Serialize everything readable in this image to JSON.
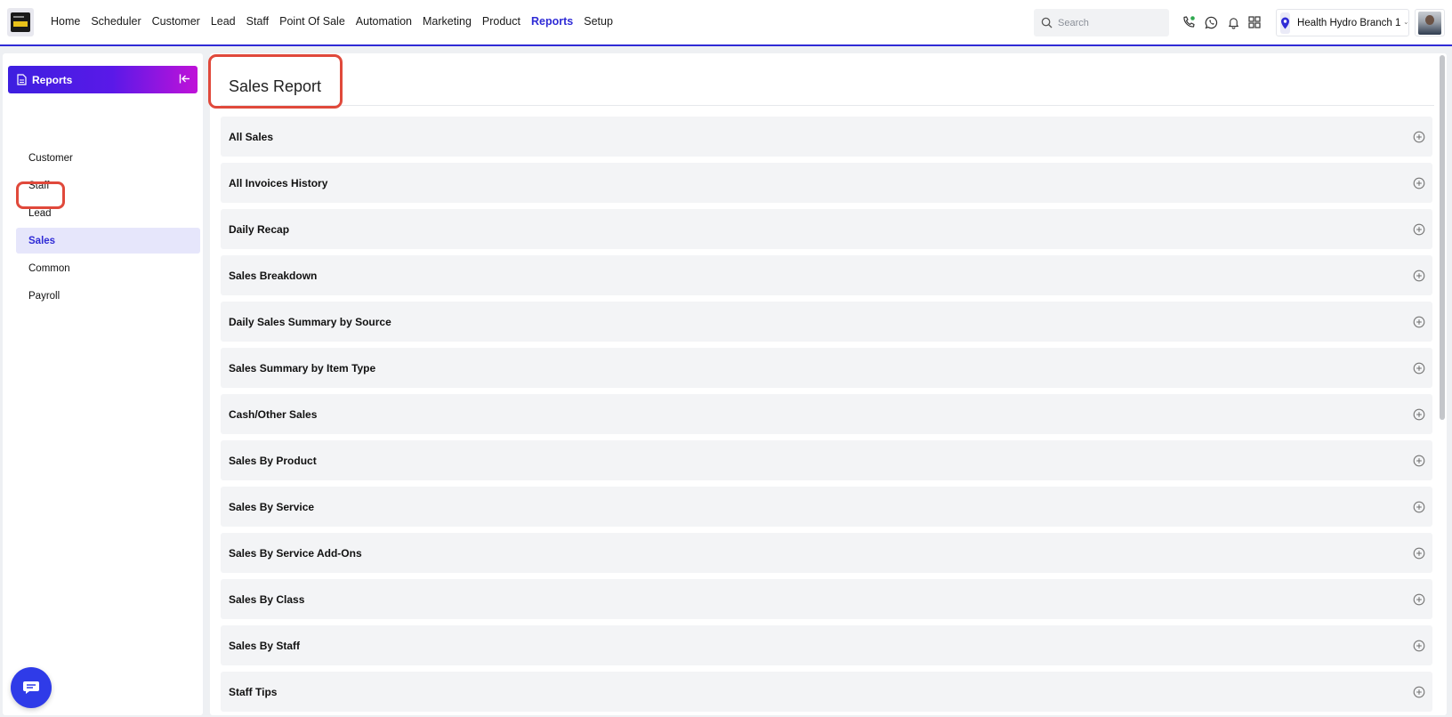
{
  "nav": {
    "items": [
      {
        "label": "Home",
        "active": false
      },
      {
        "label": "Scheduler",
        "active": false
      },
      {
        "label": "Customer",
        "active": false
      },
      {
        "label": "Lead",
        "active": false
      },
      {
        "label": "Staff",
        "active": false
      },
      {
        "label": "Point Of Sale",
        "active": false
      },
      {
        "label": "Automation",
        "active": false
      },
      {
        "label": "Marketing",
        "active": false
      },
      {
        "label": "Product",
        "active": false
      },
      {
        "label": "Reports",
        "active": true
      },
      {
        "label": "Setup",
        "active": false
      }
    ],
    "search_placeholder": "Search",
    "branch": "Health Hydro Branch 1",
    "accent": "#2f2bd6"
  },
  "sidebar": {
    "title": "Reports",
    "items": [
      {
        "label": "Customer",
        "active": false
      },
      {
        "label": "Staff",
        "active": false
      },
      {
        "label": "Lead",
        "active": false
      },
      {
        "label": "Sales",
        "active": true
      },
      {
        "label": "Common",
        "active": false
      },
      {
        "label": "Payroll",
        "active": false
      }
    ]
  },
  "main": {
    "title": "Sales Report",
    "reports": [
      "All Sales",
      "All Invoices History",
      "Daily Recap",
      "Sales Breakdown",
      "Daily Sales Summary by Source",
      "Sales Summary by Item Type",
      "Cash/Other Sales",
      "Sales By Product",
      "Sales By Service",
      "Sales By Service Add-Ons",
      "Sales By Class",
      "Sales By Staff",
      "Staff Tips"
    ]
  },
  "highlight_color": "#e0493b"
}
